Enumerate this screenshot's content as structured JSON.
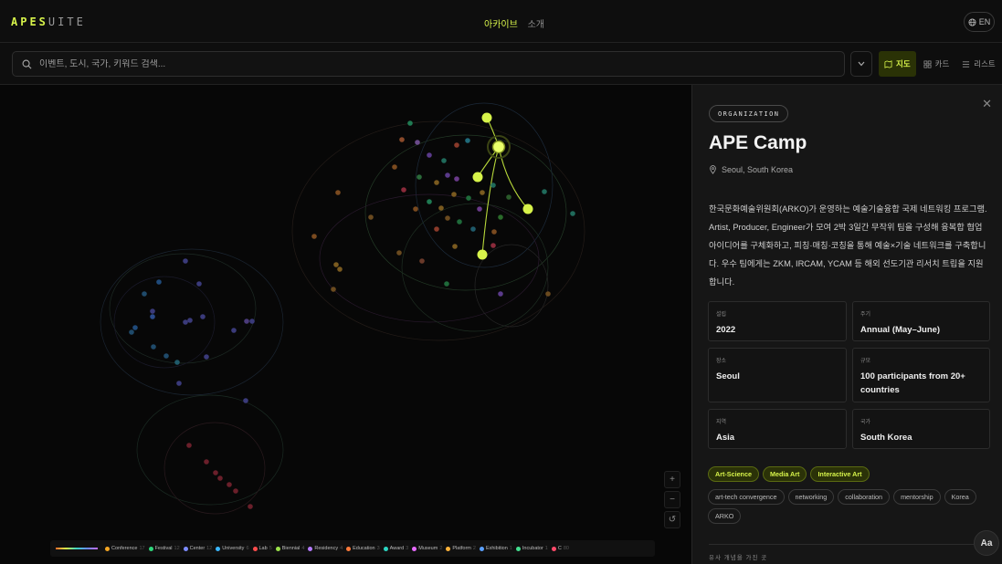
{
  "app": {
    "logo_hl": "APES",
    "logo_rest": "UITE",
    "nav_active": "아카이브",
    "nav_item": "소개",
    "lang": "EN"
  },
  "search": {
    "placeholder": "이벤트, 도시, 국가, 키워드 검색..."
  },
  "views": [
    {
      "label": "지도",
      "icon": "map-icon",
      "active": true
    },
    {
      "label": "카드",
      "icon": "grid-icon",
      "active": false
    },
    {
      "label": "리스트",
      "icon": "list-icon",
      "active": false
    }
  ],
  "zoom": {
    "in": "+",
    "out": "−",
    "reset": "↺"
  },
  "legend": [
    {
      "label": "Conference",
      "count": "17",
      "color": "#f5a623"
    },
    {
      "label": "Festival",
      "count": "12",
      "color": "#2fd77c"
    },
    {
      "label": "Center",
      "count": "12",
      "color": "#7d8cff"
    },
    {
      "label": "University",
      "count": "6",
      "color": "#3ab8ff"
    },
    {
      "label": "Lab",
      "count": "5",
      "color": "#ff4d4d"
    },
    {
      "label": "Biennial",
      "count": "4",
      "color": "#9be34a"
    },
    {
      "label": "Residency",
      "count": "4",
      "color": "#b57bff"
    },
    {
      "label": "Education",
      "count": "3",
      "color": "#ff7a3a"
    },
    {
      "label": "Award",
      "count": "3",
      "color": "#2cd6c2"
    },
    {
      "label": "Museum",
      "count": "2",
      "color": "#e86bff"
    },
    {
      "label": "Platform",
      "count": "2",
      "color": "#ffb43a"
    },
    {
      "label": "Exhibition",
      "count": "1",
      "color": "#5aa0ff"
    },
    {
      "label": "Incubator",
      "count": "1",
      "color": "#43e08f"
    },
    {
      "label": "C",
      "count": "80",
      "color": "#ff4a6a"
    }
  ],
  "detail": {
    "badge": "ORGANIZATION",
    "title": "APE Camp",
    "location": "Seoul, South Korea",
    "description": "한국문화예술위원회(ARKO)가 운영하는 예술기술융합 국제 네트워킹 프로그램. Artist, Producer, Engineer가 모여 2박 3일간 무작위 팀을 구성해 융복합 협업 아이디어를 구체화하고, 피칭·매칭·코칭을 통해 예술×기술 네트워크를 구축합니다. 우수 팀에게는 ZKM, IRCAM, YCAM 등 해외 선도기관 리서치 트립을 지원합니다.",
    "fields": [
      {
        "key": "설립",
        "value": "2022"
      },
      {
        "key": "주기",
        "value": "Annual (May–June)"
      },
      {
        "key": "장소",
        "value": "Seoul"
      },
      {
        "key": "규모",
        "value": "100 participants from 20+ countries"
      },
      {
        "key": "지역",
        "value": "Asia"
      },
      {
        "key": "국가",
        "value": "South Korea"
      }
    ],
    "tags_highlight": [
      "Art-Science",
      "Media Art",
      "Interactive Art"
    ],
    "tags": [
      "art-tech convergence",
      "networking",
      "collaboration",
      "mentorship",
      "Korea",
      "ARKO"
    ],
    "similar_label": "유사 개념을 가진 곳",
    "font_button": "Aa"
  },
  "colors": {
    "accent": "#d7f34a",
    "background": "#0c0c0c",
    "panel": "#161616"
  }
}
